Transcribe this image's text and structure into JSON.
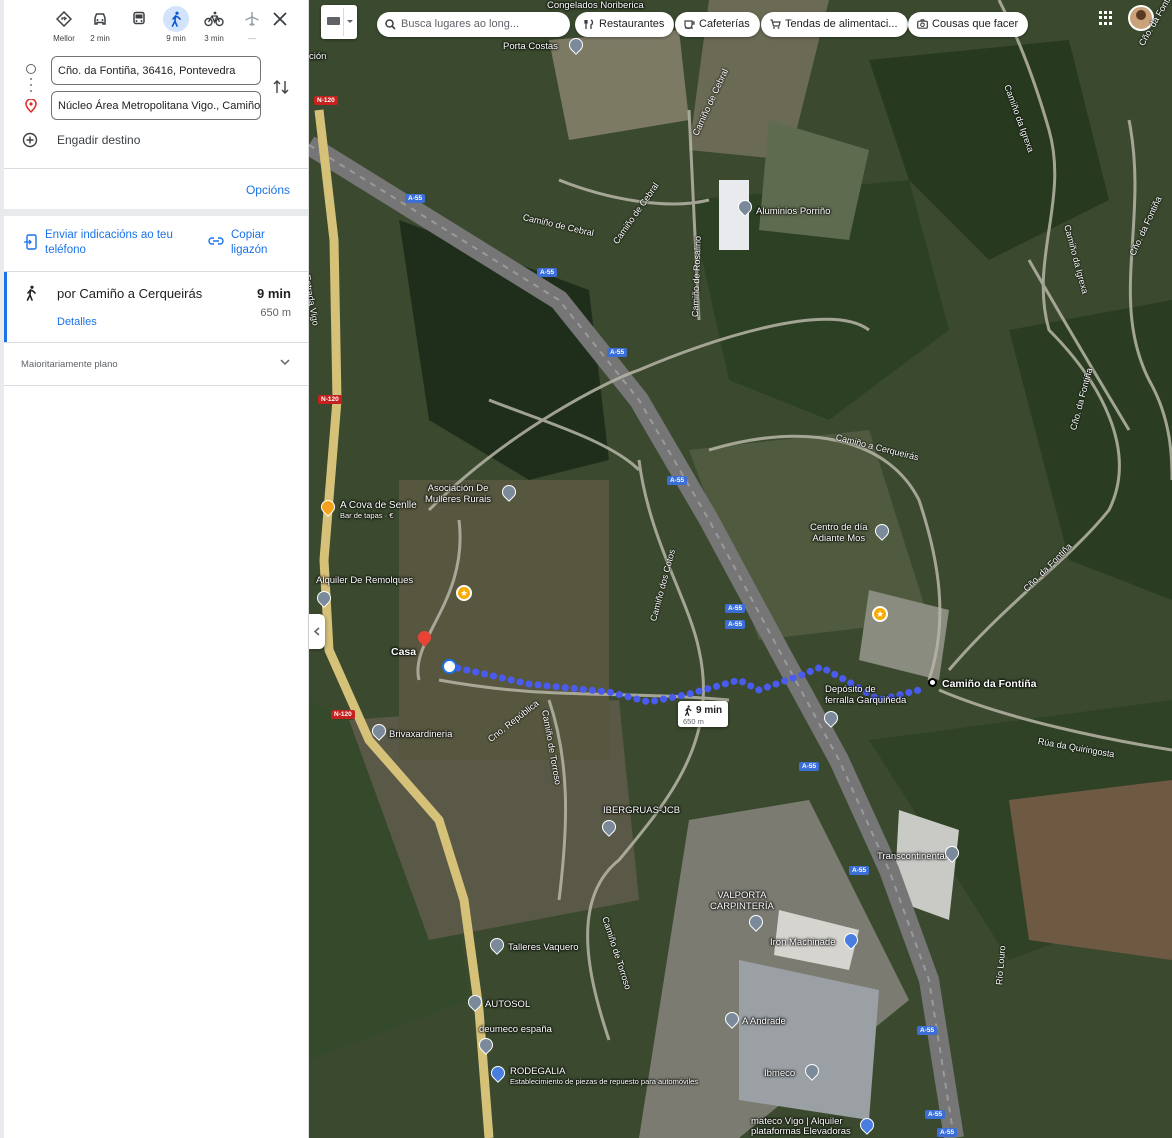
{
  "travel_modes": [
    {
      "label": "Mellor",
      "icon": "diamond-directions-icon"
    },
    {
      "label": "2 min",
      "icon": "car-icon"
    },
    {
      "label": "",
      "icon": "train-icon"
    },
    {
      "label": "9 min",
      "icon": "walk-icon",
      "active": true
    },
    {
      "label": "3 min",
      "icon": "bicycle-icon"
    },
    {
      "label": "—",
      "icon": "plane-icon"
    }
  ],
  "origin": {
    "value": "Cño. da Fontiña, 36416, Pontevedra"
  },
  "destination": {
    "value": "Núcleo Área Metropolitana Vigo., Camiño"
  },
  "add_destination": "Engadir destino",
  "options_label": "Opcións",
  "send_directions": "Enviar indicacións ao teu teléfono",
  "copy_link": "Copiar ligazón",
  "route": {
    "name": "por Camiño a Cerqueirás",
    "time": "9 min",
    "distance": "650 m",
    "details": "Detalles"
  },
  "terrain_note": "Maioritariamente plano",
  "search": {
    "placeholder": "Busca lugares ao long..."
  },
  "chips": [
    "Restaurantes",
    "Cafeterías",
    "Tendas de alimentaci...",
    "Cousas que facer"
  ],
  "map_labels": {
    "congelados": "Congelados Noriberica",
    "porta_costas": "Porta Costas",
    "aluminios": "Aluminios Porriño",
    "asociacion": "Asociación De\nMulleres Rurais",
    "cova": "A Cova de Senlle",
    "cova_sub": "Bar de tapas · €",
    "alquiler": "Alquiler De Remolques",
    "casa": "Casa",
    "centro": "Centro de día\nAdiante Mos",
    "deposito": "Depósito de\nferralla Garquiñeda",
    "camino_fontina": "Camiño da Fontiña",
    "brivaxardineria": "Brivaxardineria",
    "ibergruas": "IBERGRUAS-JCB",
    "transcontinental": "Transcontinental",
    "valporta": "VALPORTA\nCARPINTERÍA",
    "iron_machinade": "Iron Machinade",
    "talleres": "Talleres Vaquero",
    "autosol": "AUTOSOL",
    "deumeco": "deumeco españa",
    "rodegalia": "RODEGALIA",
    "rodegalia_sub": "Establecimiento de piezas de repuesto para automóviles",
    "andrade": "A Andrade",
    "ibmeco": "Ibmeco",
    "matecovigo": "mateco Vigo | Alquiler\nplataformas Elevadoras",
    "cion": "ción"
  },
  "road_labels": {
    "cebral": "Camiño de Cebral",
    "cebral2": "Camiño de Cebral",
    "cebral3": "Camiño de Cebral",
    "rosalino": "Camiño de Rosalino",
    "cerqueiras": "Camiño a Cerqueirás",
    "iglesia": "Camiño da Igrexa",
    "iglesia2": "Camiño da Igrexa",
    "fontina_road": "Cño. da Fontiña",
    "fontina_road2": "Cño. da Fontiña",
    "fontina_road3": "Cño. da Fontiña",
    "quiringosta": "Rúa da Quiringosta",
    "republica": "Cno. República",
    "torroso": "Camiño de Torroso",
    "torroso2": "Camiño de Torroso",
    "ctrs": "Camiño dos Cotos",
    "rio_louro": "Río Louro",
    "vigo": "Estrada Vigo",
    "fontina_top": "Cño. da Fontiña"
  },
  "shields": [
    "A-55",
    "A-55",
    "A-55",
    "A-55",
    "A-55",
    "A-55",
    "A-55",
    "A-55",
    "A-55",
    "A-55",
    "A-55",
    "N-120",
    "N-120",
    "N-120"
  ],
  "tip": {
    "time": "9 min",
    "distance": "650 m"
  },
  "colors": {
    "accent": "#1a73e8",
    "route": "#4a5cf0"
  }
}
